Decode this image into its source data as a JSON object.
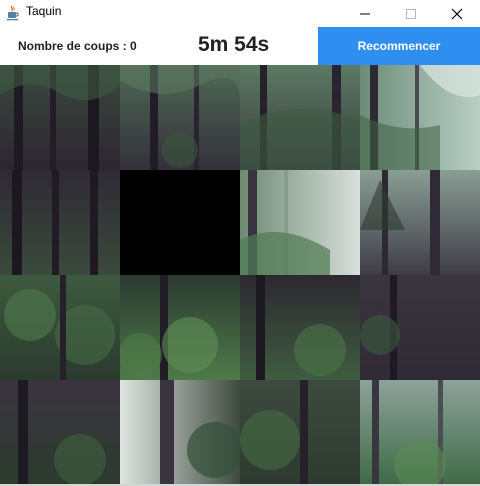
{
  "window": {
    "title": "Taquin",
    "icon": "java-cup-icon",
    "controls": [
      "minimize-icon",
      "maximize-icon",
      "close-icon"
    ]
  },
  "toolbar": {
    "moves_label": "Nombre de coups : 0",
    "timer": "5m 54s",
    "restart_label": "Recommencer",
    "accent": "#2f8ff0"
  },
  "board": {
    "rows": 4,
    "cols": 4,
    "empty_tile": {
      "row": 1,
      "col": 1
    },
    "empty_color": "#000000",
    "image": "misty forest photograph split into puzzle tiles"
  }
}
